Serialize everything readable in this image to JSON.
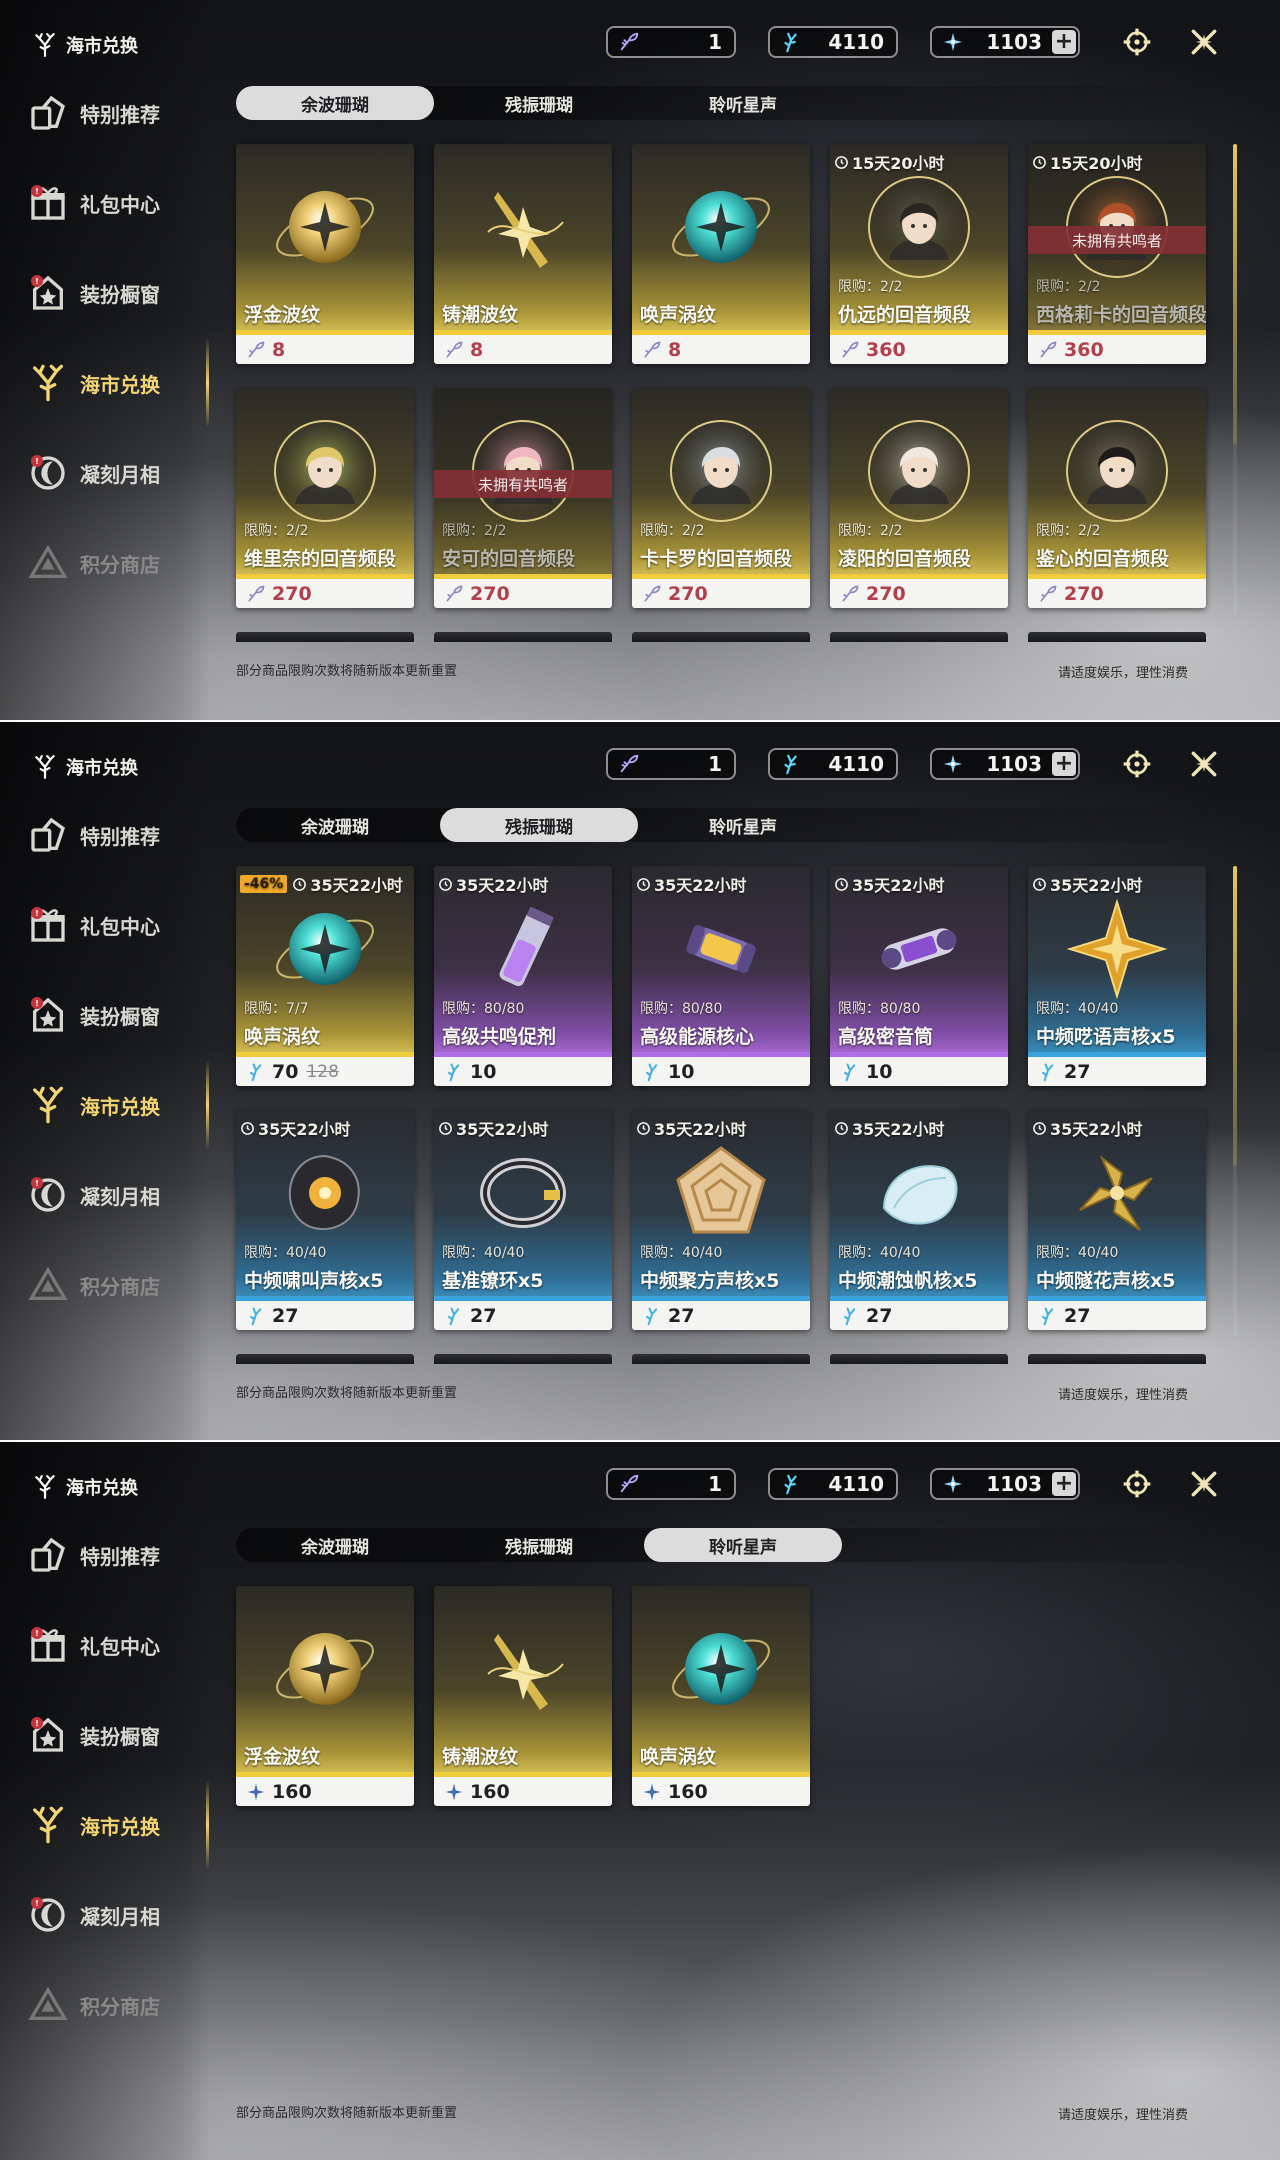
{
  "brand": {
    "label": "海市兑换"
  },
  "nav": [
    {
      "label": "特别推荐",
      "icon": "featured-icon",
      "badge": ""
    },
    {
      "label": "礼包中心",
      "icon": "gift-icon",
      "badge": "!"
    },
    {
      "label": "装扮橱窗",
      "icon": "outfit-icon",
      "badge": "!"
    },
    {
      "label": "海市兑换",
      "icon": "coral-icon",
      "badge": ""
    },
    {
      "label": "凝刻月相",
      "icon": "moon-icon",
      "badge": "!"
    },
    {
      "label": "积分商店",
      "icon": "points-icon",
      "badge": ""
    }
  ],
  "currencies": [
    {
      "value": "1",
      "icon": "feather-currency-icon"
    },
    {
      "value": "4110",
      "icon": "blue-coral-icon"
    },
    {
      "value": "1103",
      "icon": "star-coral-icon"
    }
  ],
  "tabs": [
    "余波珊瑚",
    "残振珊瑚",
    "聆听星声"
  ],
  "footer": {
    "note": "部分商品限购次数将随新版本更新重置",
    "right": "请适度娱乐，理性消费"
  },
  "colors": {
    "accent": "#f2d472",
    "gold": "#f0cc3c",
    "purple": "#b06ee6",
    "blue": "#3aa2dc",
    "locked": "#823034",
    "discount": "#f0a92a"
  },
  "panels": [
    {
      "active_tab": 0,
      "cards": [
        {
          "title": "浮金波纹",
          "price": "8",
          "price_color": "red",
          "rarity": "gold",
          "visual": "golden-orb",
          "timer": "",
          "limit": "",
          "lock": ""
        },
        {
          "title": "铸潮波纹",
          "price": "8",
          "price_color": "red",
          "rarity": "gold",
          "visual": "golden-blade",
          "timer": "",
          "limit": "",
          "lock": ""
        },
        {
          "title": "唤声涡纹",
          "price": "8",
          "price_color": "red",
          "rarity": "gold",
          "visual": "teal-orb",
          "timer": "",
          "limit": "",
          "lock": ""
        },
        {
          "title": "仇远的回音频段",
          "price": "360",
          "price_color": "red",
          "rarity": "gold",
          "visual": "portrait-dark",
          "timer": "15天20小时",
          "limit": "限购：2/2",
          "lock": ""
        },
        {
          "title": "西格莉卡的回音频段",
          "price": "360",
          "price_color": "red",
          "rarity": "gold",
          "visual": "portrait-orange",
          "timer": "15天20小时",
          "limit": "限购：2/2",
          "lock": "未拥有共鸣者"
        },
        {
          "title": "维里奈的回音频段",
          "price": "270",
          "price_color": "red",
          "rarity": "gold",
          "visual": "portrait-green",
          "timer": "",
          "limit": "限购：2/2",
          "lock": ""
        },
        {
          "title": "安可的回音频段",
          "price": "270",
          "price_color": "red",
          "rarity": "gold",
          "visual": "portrait-pink",
          "timer": "",
          "limit": "限购：2/2",
          "lock": "未拥有共鸣者"
        },
        {
          "title": "卡卡罗的回音频段",
          "price": "270",
          "price_color": "red",
          "rarity": "gold",
          "visual": "portrait-silver",
          "timer": "",
          "limit": "限购：2/2",
          "lock": ""
        },
        {
          "title": "凌阳的回音频段",
          "price": "270",
          "price_color": "red",
          "rarity": "gold",
          "visual": "portrait-white",
          "timer": "",
          "limit": "限购：2/2",
          "lock": ""
        },
        {
          "title": "鉴心的回音频段",
          "price": "270",
          "price_color": "red",
          "rarity": "gold",
          "visual": "portrait-black",
          "timer": "",
          "limit": "限购：2/2",
          "lock": ""
        }
      ]
    },
    {
      "active_tab": 1,
      "cards": [
        {
          "title": "唤声涡纹",
          "price": "70",
          "old_price": "128",
          "discount": "-46%",
          "price_color": "dark",
          "rarity": "gold",
          "visual": "teal-orb",
          "timer": "35天22小时",
          "limit": "限购：7/7",
          "lock": ""
        },
        {
          "title": "高级共鸣促剂",
          "price": "10",
          "price_color": "dark",
          "rarity": "purple",
          "visual": "vial",
          "timer": "35天22小时",
          "limit": "限购：80/80",
          "lock": ""
        },
        {
          "title": "高级能源核心",
          "price": "10",
          "price_color": "dark",
          "rarity": "purple",
          "visual": "energy-core",
          "timer": "35天22小时",
          "limit": "限购：80/80",
          "lock": ""
        },
        {
          "title": "高级密音筒",
          "price": "10",
          "price_color": "dark",
          "rarity": "purple",
          "visual": "sound-tube",
          "timer": "35天22小时",
          "limit": "限购：80/80",
          "lock": ""
        },
        {
          "title": "中频呓语声核x5",
          "price": "27",
          "price_color": "dark",
          "rarity": "blue",
          "visual": "gold-star",
          "timer": "35天22小时",
          "limit": "限购：40/40",
          "lock": ""
        },
        {
          "title": "中频啸叫声核x5",
          "price": "27",
          "price_color": "dark",
          "rarity": "blue",
          "visual": "dark-core",
          "timer": "35天22小时",
          "limit": "限购：40/40",
          "lock": ""
        },
        {
          "title": "基准镣环x5",
          "price": "27",
          "price_color": "dark",
          "rarity": "blue",
          "visual": "ring",
          "timer": "35天22小时",
          "limit": "限购：40/40",
          "lock": ""
        },
        {
          "title": "中频聚方声核x5",
          "price": "27",
          "price_color": "dark",
          "rarity": "blue",
          "visual": "pentagon",
          "timer": "35天22小时",
          "limit": "限购：40/40",
          "lock": ""
        },
        {
          "title": "中频潮蚀帆核x5",
          "price": "27",
          "price_color": "dark",
          "rarity": "blue",
          "visual": "shell",
          "timer": "35天22小时",
          "limit": "限购：40/40",
          "lock": ""
        },
        {
          "title": "中频隧花声核x5",
          "price": "27",
          "price_color": "dark",
          "rarity": "blue",
          "visual": "gold-flower",
          "timer": "35天22小时",
          "limit": "限购：40/40",
          "lock": ""
        }
      ]
    },
    {
      "active_tab": 2,
      "cards": [
        {
          "title": "浮金波纹",
          "price": "160",
          "price_color": "dark",
          "rarity": "gold",
          "visual": "golden-orb",
          "timer": "",
          "limit": "",
          "lock": ""
        },
        {
          "title": "铸潮波纹",
          "price": "160",
          "price_color": "dark",
          "rarity": "gold",
          "visual": "golden-blade",
          "timer": "",
          "limit": "",
          "lock": ""
        },
        {
          "title": "唤声涡纹",
          "price": "160",
          "price_color": "dark",
          "rarity": "gold",
          "visual": "teal-orb",
          "timer": "",
          "limit": "",
          "lock": ""
        }
      ]
    }
  ]
}
